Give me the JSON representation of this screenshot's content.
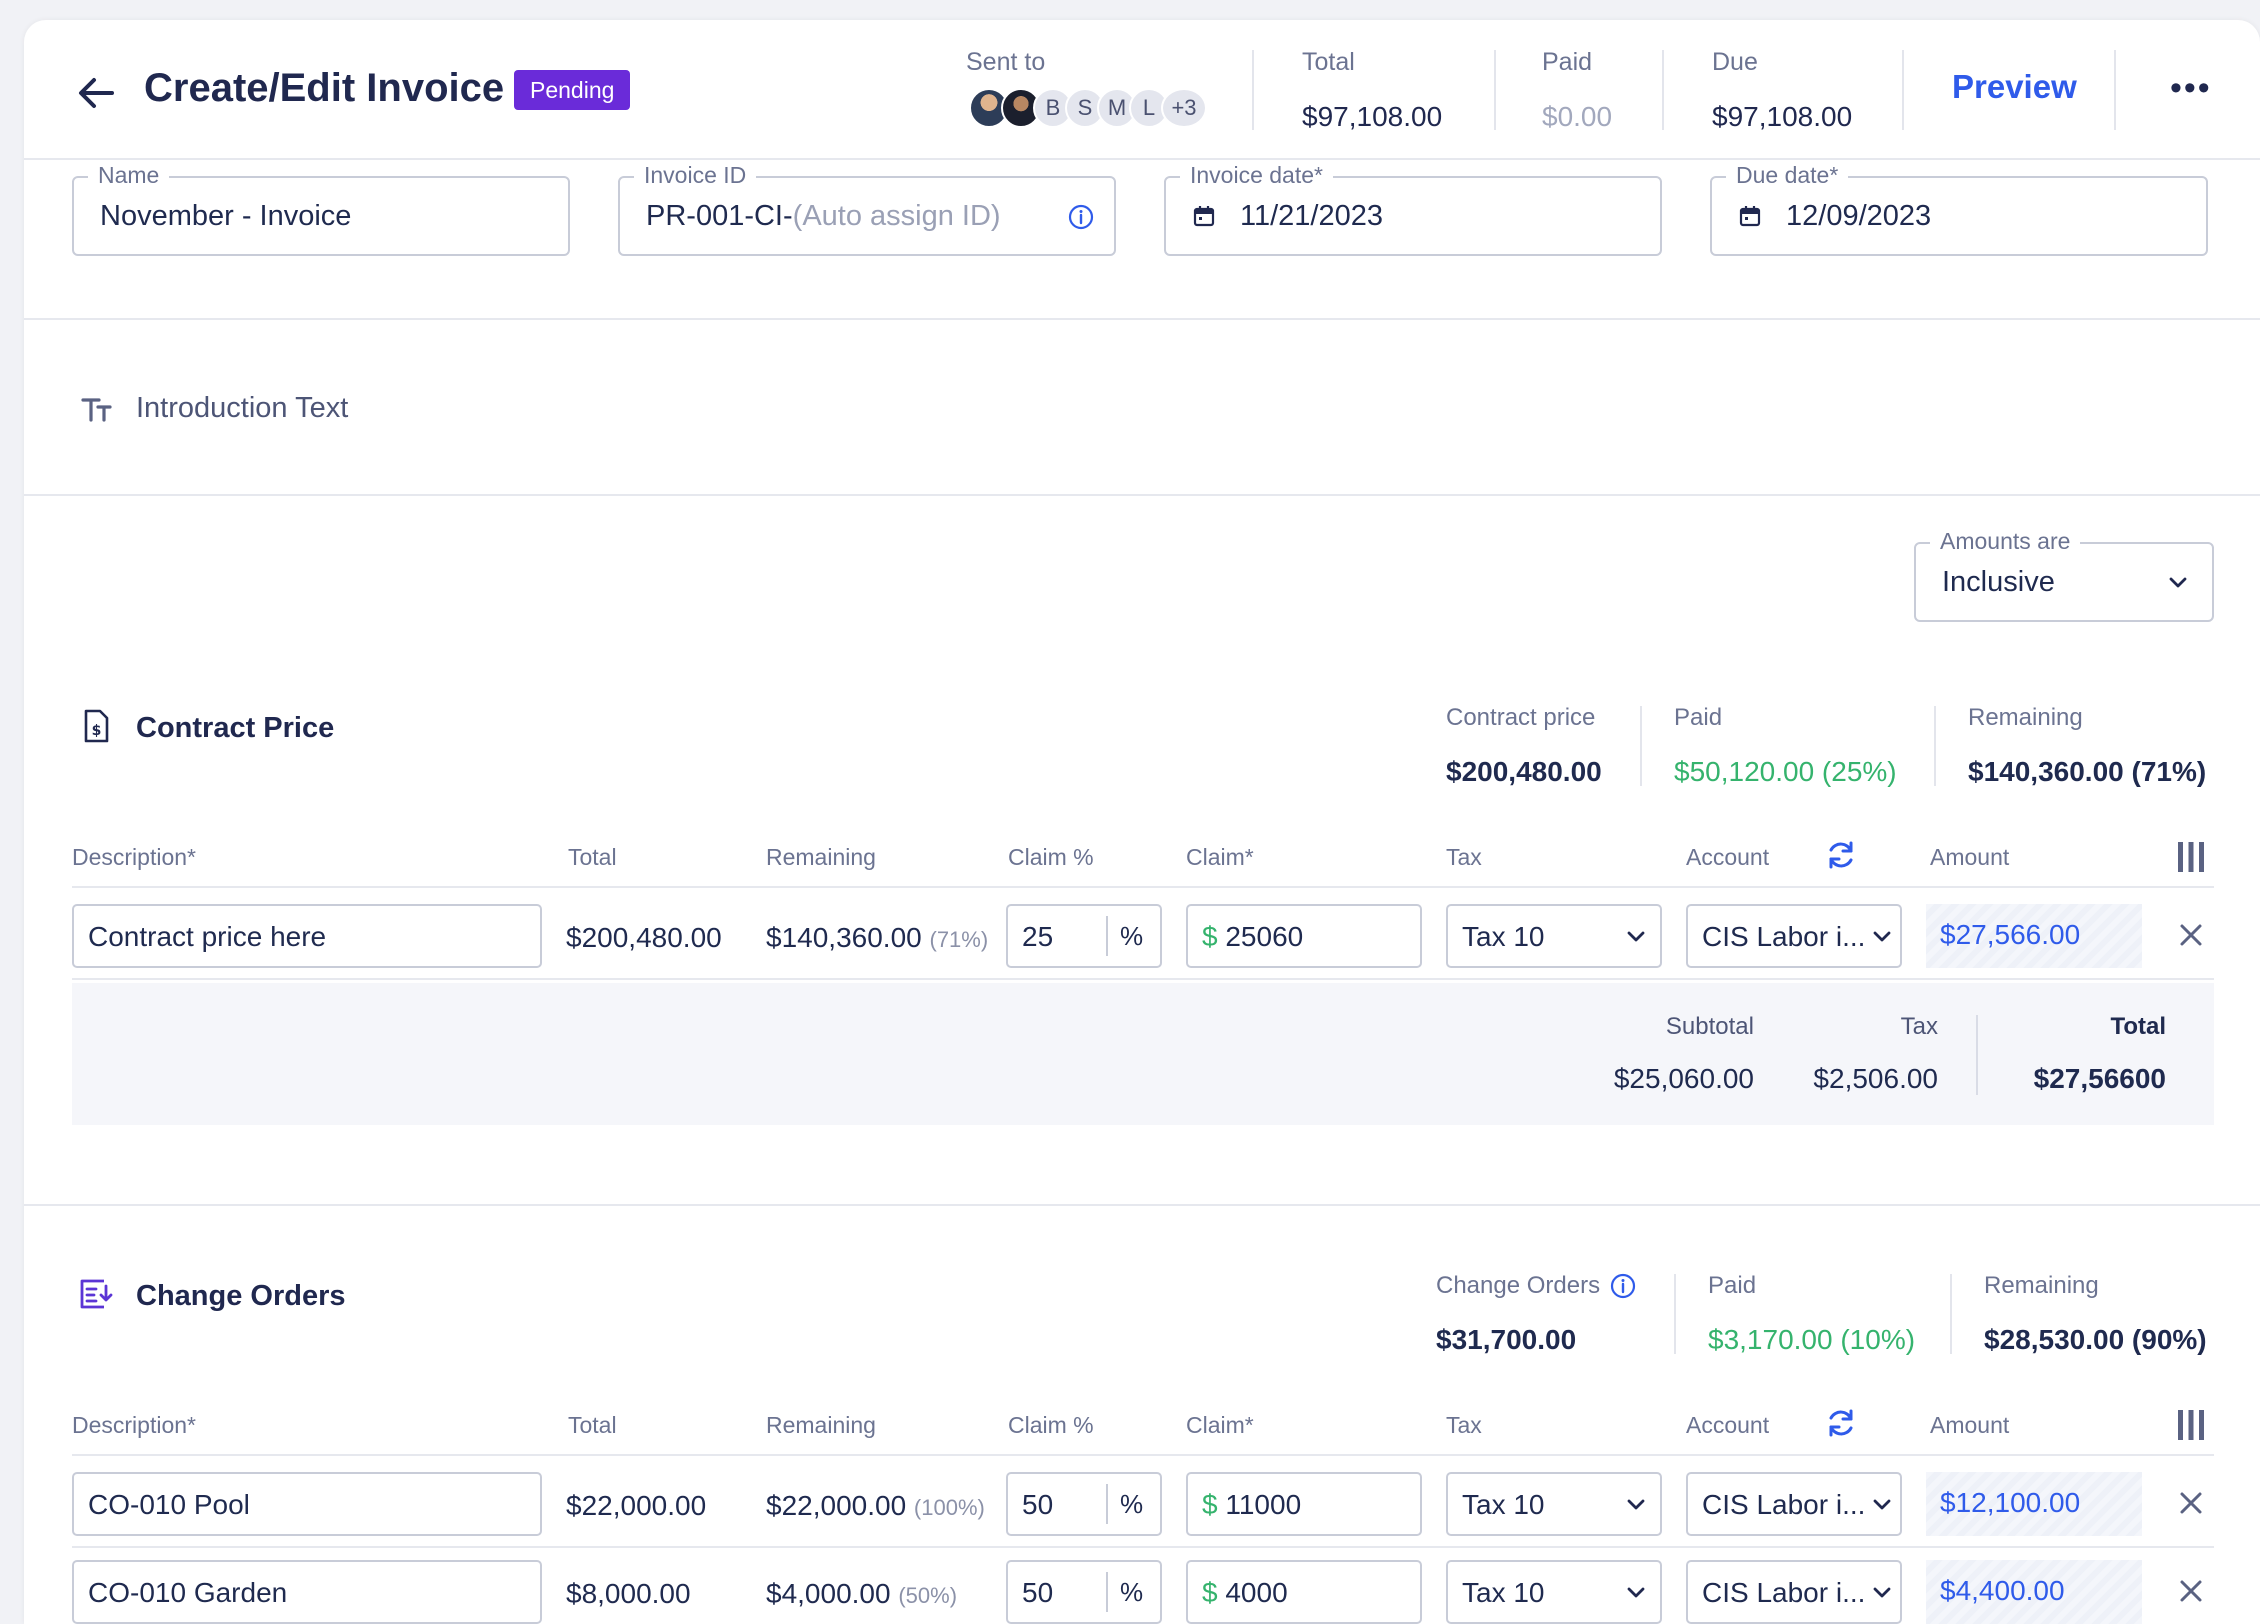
{
  "header": {
    "title": "Create/Edit Invoice",
    "status": "Pending",
    "sent_to_label": "Sent to",
    "recipients": [
      "B",
      "S",
      "M",
      "L"
    ],
    "recipients_more": "+3",
    "total_label": "Total",
    "total_value": "$97,108.00",
    "paid_label": "Paid",
    "paid_value": "$0.00",
    "due_label": "Due",
    "due_value": "$97,108.00",
    "preview_label": "Preview",
    "menu_label": "•••"
  },
  "fields": {
    "name": {
      "label": "Name",
      "value": "November - Invoice"
    },
    "invoice_id": {
      "label": "Invoice ID",
      "value": "PR-001-CI-",
      "placeholder": "(Auto assign ID)"
    },
    "invoice_date": {
      "label": "Invoice date*",
      "value": "11/21/2023"
    },
    "due_date": {
      "label": "Due date*",
      "value": "12/09/2023"
    }
  },
  "intro": {
    "label": "Introduction Text"
  },
  "amounts": {
    "label": "Amounts are",
    "value": "Inclusive"
  },
  "columns": {
    "description": "Description*",
    "total": "Total",
    "remaining": "Remaining",
    "claim_pct": "Claim %",
    "claim": "Claim*",
    "tax": "Tax",
    "account": "Account",
    "amount": "Amount"
  },
  "contract": {
    "title": "Contract Price",
    "stats": {
      "contract_label": "Contract price",
      "contract_value": "$200,480.00",
      "paid_label": "Paid",
      "paid_value": "$50,120.00 (25%)",
      "remaining_label": "Remaining",
      "remaining_value": "$140,360.00 (71%)"
    },
    "rows": [
      {
        "description": "Contract price here",
        "total": "$200,480.00",
        "remaining": "$140,360.00",
        "remaining_pct": "(71%)",
        "claim_pct": "25",
        "claim": "25060",
        "tax": "Tax 10",
        "account": "CIS Labor i...",
        "amount": "$27,566.00"
      }
    ],
    "totals": {
      "subtotal_label": "Subtotal",
      "subtotal_value": "$25,060.00",
      "tax_label": "Tax",
      "tax_value": "$2,506.00",
      "total_label": "Total",
      "total_value": "$27,56600"
    }
  },
  "change_orders": {
    "title": "Change Orders",
    "stats": {
      "co_label": "Change Orders",
      "co_value": "$31,700.00",
      "paid_label": "Paid",
      "paid_value": "$3,170.00 (10%)",
      "remaining_label": "Remaining",
      "remaining_value": "$28,530.00 (90%)"
    },
    "rows": [
      {
        "description": "CO-010 Pool",
        "total": "$22,000.00",
        "remaining": "$22,000.00",
        "remaining_pct": "(100%)",
        "claim_pct": "50",
        "claim": "11000",
        "tax": "Tax 10",
        "account": "CIS Labor i...",
        "amount": "$12,100.00"
      },
      {
        "description": "CO-010 Garden",
        "total": "$8,000.00",
        "remaining": "$4,000.00",
        "remaining_pct": "(50%)",
        "claim_pct": "50",
        "claim": "4000",
        "tax": "Tax 10",
        "account": "CIS Labor i...",
        "amount": "$4,400.00"
      }
    ]
  },
  "symbols": {
    "percent": "%",
    "dollar": "$"
  },
  "colors": {
    "accent": "#2f5bea",
    "badge": "#6a2bd9",
    "green": "#35b36d",
    "text": "#1f2a4f"
  }
}
